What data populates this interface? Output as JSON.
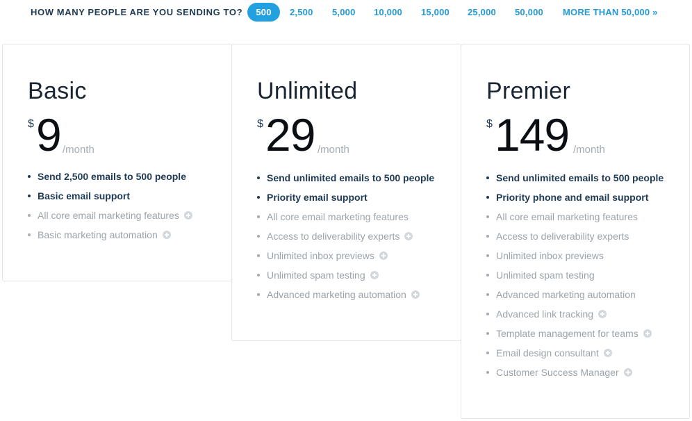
{
  "recipients": {
    "question": "HOW MANY PEOPLE ARE YOU SENDING TO?",
    "options": [
      "500",
      "2,500",
      "5,000",
      "10,000",
      "15,000",
      "25,000",
      "50,000",
      "MORE THAN 50,000 »"
    ],
    "selected": "500"
  },
  "plans": [
    {
      "name": "Basic",
      "currency": "$",
      "amount": "9",
      "period": "/month",
      "features": [
        {
          "text": "Send 2,500 emails to 500 people",
          "emphasis": true,
          "info": false
        },
        {
          "text": "Basic email support",
          "emphasis": true,
          "info": false
        },
        {
          "text": "All core email marketing features",
          "emphasis": false,
          "info": true
        },
        {
          "text": "Basic marketing automation",
          "emphasis": false,
          "info": true
        }
      ]
    },
    {
      "name": "Unlimited",
      "currency": "$",
      "amount": "29",
      "period": "/month",
      "features": [
        {
          "text": "Send unlimited emails to 500 people",
          "emphasis": true,
          "info": false
        },
        {
          "text": "Priority email support",
          "emphasis": true,
          "info": false
        },
        {
          "text": "All core email marketing features",
          "emphasis": false,
          "info": false
        },
        {
          "text": "Access to deliverability experts",
          "emphasis": false,
          "info": true
        },
        {
          "text": "Unlimited inbox previews",
          "emphasis": false,
          "info": true
        },
        {
          "text": "Unlimited spam testing",
          "emphasis": false,
          "info": true
        },
        {
          "text": "Advanced marketing automation",
          "emphasis": false,
          "info": true
        }
      ]
    },
    {
      "name": "Premier",
      "currency": "$",
      "amount": "149",
      "period": "/month",
      "features": [
        {
          "text": "Send unlimited emails to 500 people",
          "emphasis": true,
          "info": false
        },
        {
          "text": "Priority phone and email support",
          "emphasis": true,
          "info": false
        },
        {
          "text": "All core email marketing features",
          "emphasis": false,
          "info": false
        },
        {
          "text": "Access to deliverability experts",
          "emphasis": false,
          "info": false
        },
        {
          "text": "Unlimited inbox previews",
          "emphasis": false,
          "info": false
        },
        {
          "text": "Unlimited spam testing",
          "emphasis": false,
          "info": false
        },
        {
          "text": "Advanced marketing automation",
          "emphasis": false,
          "info": false
        },
        {
          "text": "Advanced link tracking",
          "emphasis": false,
          "info": true
        },
        {
          "text": "Template management for teams",
          "emphasis": false,
          "info": true
        },
        {
          "text": "Email design consultant",
          "emphasis": false,
          "info": true
        },
        {
          "text": "Customer Success Manager",
          "emphasis": false,
          "info": true
        }
      ]
    }
  ],
  "colors": {
    "accent": "#23a0e0",
    "link": "#239ad6",
    "heading": "#1e3a54",
    "muted": "#9aa3ac",
    "border": "#e1e4e7"
  }
}
